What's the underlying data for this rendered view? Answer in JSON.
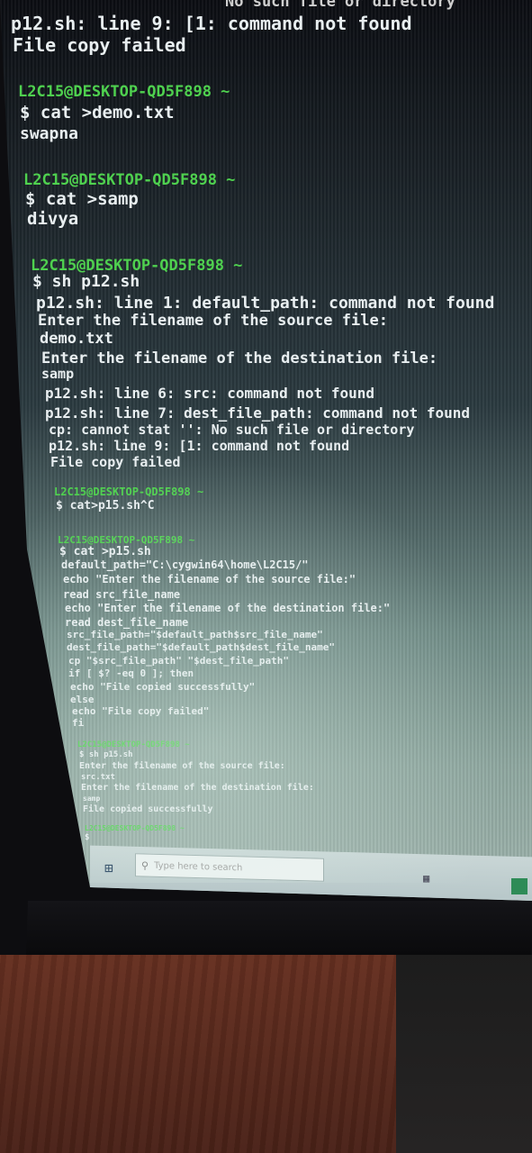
{
  "terminal": {
    "lines": [
      "No such file or directory",
      "p12.sh: line 9: [1: command not found",
      "File copy failed",
      "L2C15@DESKTOP-QD5F898 ~",
      "$ cat >demo.txt",
      "swapna",
      "L2C15@DESKTOP-QD5F898 ~",
      "$ cat >samp",
      "divya",
      "L2C15@DESKTOP-QD5F898 ~",
      "$ sh p12.sh",
      "p12.sh: line 1: default_path: command not found",
      "Enter the filename of the source file:",
      "demo.txt",
      "Enter the filename of the destination file:",
      "samp",
      "p12.sh: line 6: src: command not found",
      "p12.sh: line 7: dest_file_path: command not found",
      "cp: cannot stat '': No such file or directory",
      "p12.sh: line 9: [1: command not found",
      "File copy failed",
      "L2C15@DESKTOP-QD5F898 ~",
      "$ cat>p15.sh^C",
      "L2C15@DESKTOP-QD5F898 ~",
      "$ cat >p15.sh",
      "default_path=\"C:\\cygwin64\\home\\L2C15/\"",
      "echo \"Enter the filename of the source file:\"",
      "read src_file_name",
      "echo \"Enter the filename of the destination file:\"",
      "read dest_file_name",
      "src_file_path=\"$default_path$src_file_name\"",
      "dest_file_path=\"$default_path$dest_file_name\"",
      "cp \"$src_file_path\" \"$dest_file_path\"",
      "if [ $? -eq 0 ]; then",
      "echo \"File copied successfully\"",
      "else",
      "echo \"File copy failed\"",
      "fi",
      "L2C15@DESKTOP-QD5F898 ~",
      "$ sh p15.sh",
      "Enter the filename of the source file:",
      "src.txt",
      "Enter the filename of the destination file:",
      "samp",
      "File copied successfully",
      "L2C15@DESKTOP-QD5F898 ~",
      "$"
    ]
  },
  "taskbar": {
    "search_placeholder": "Type here to search",
    "start_icon": "windows-start-icon",
    "search_icon": "search-icon",
    "tray_icon": "task-view-icon"
  },
  "colors": {
    "prompt": "#4fd14f",
    "text": "#e8eef0",
    "taskbar": "#c2d0d0"
  }
}
